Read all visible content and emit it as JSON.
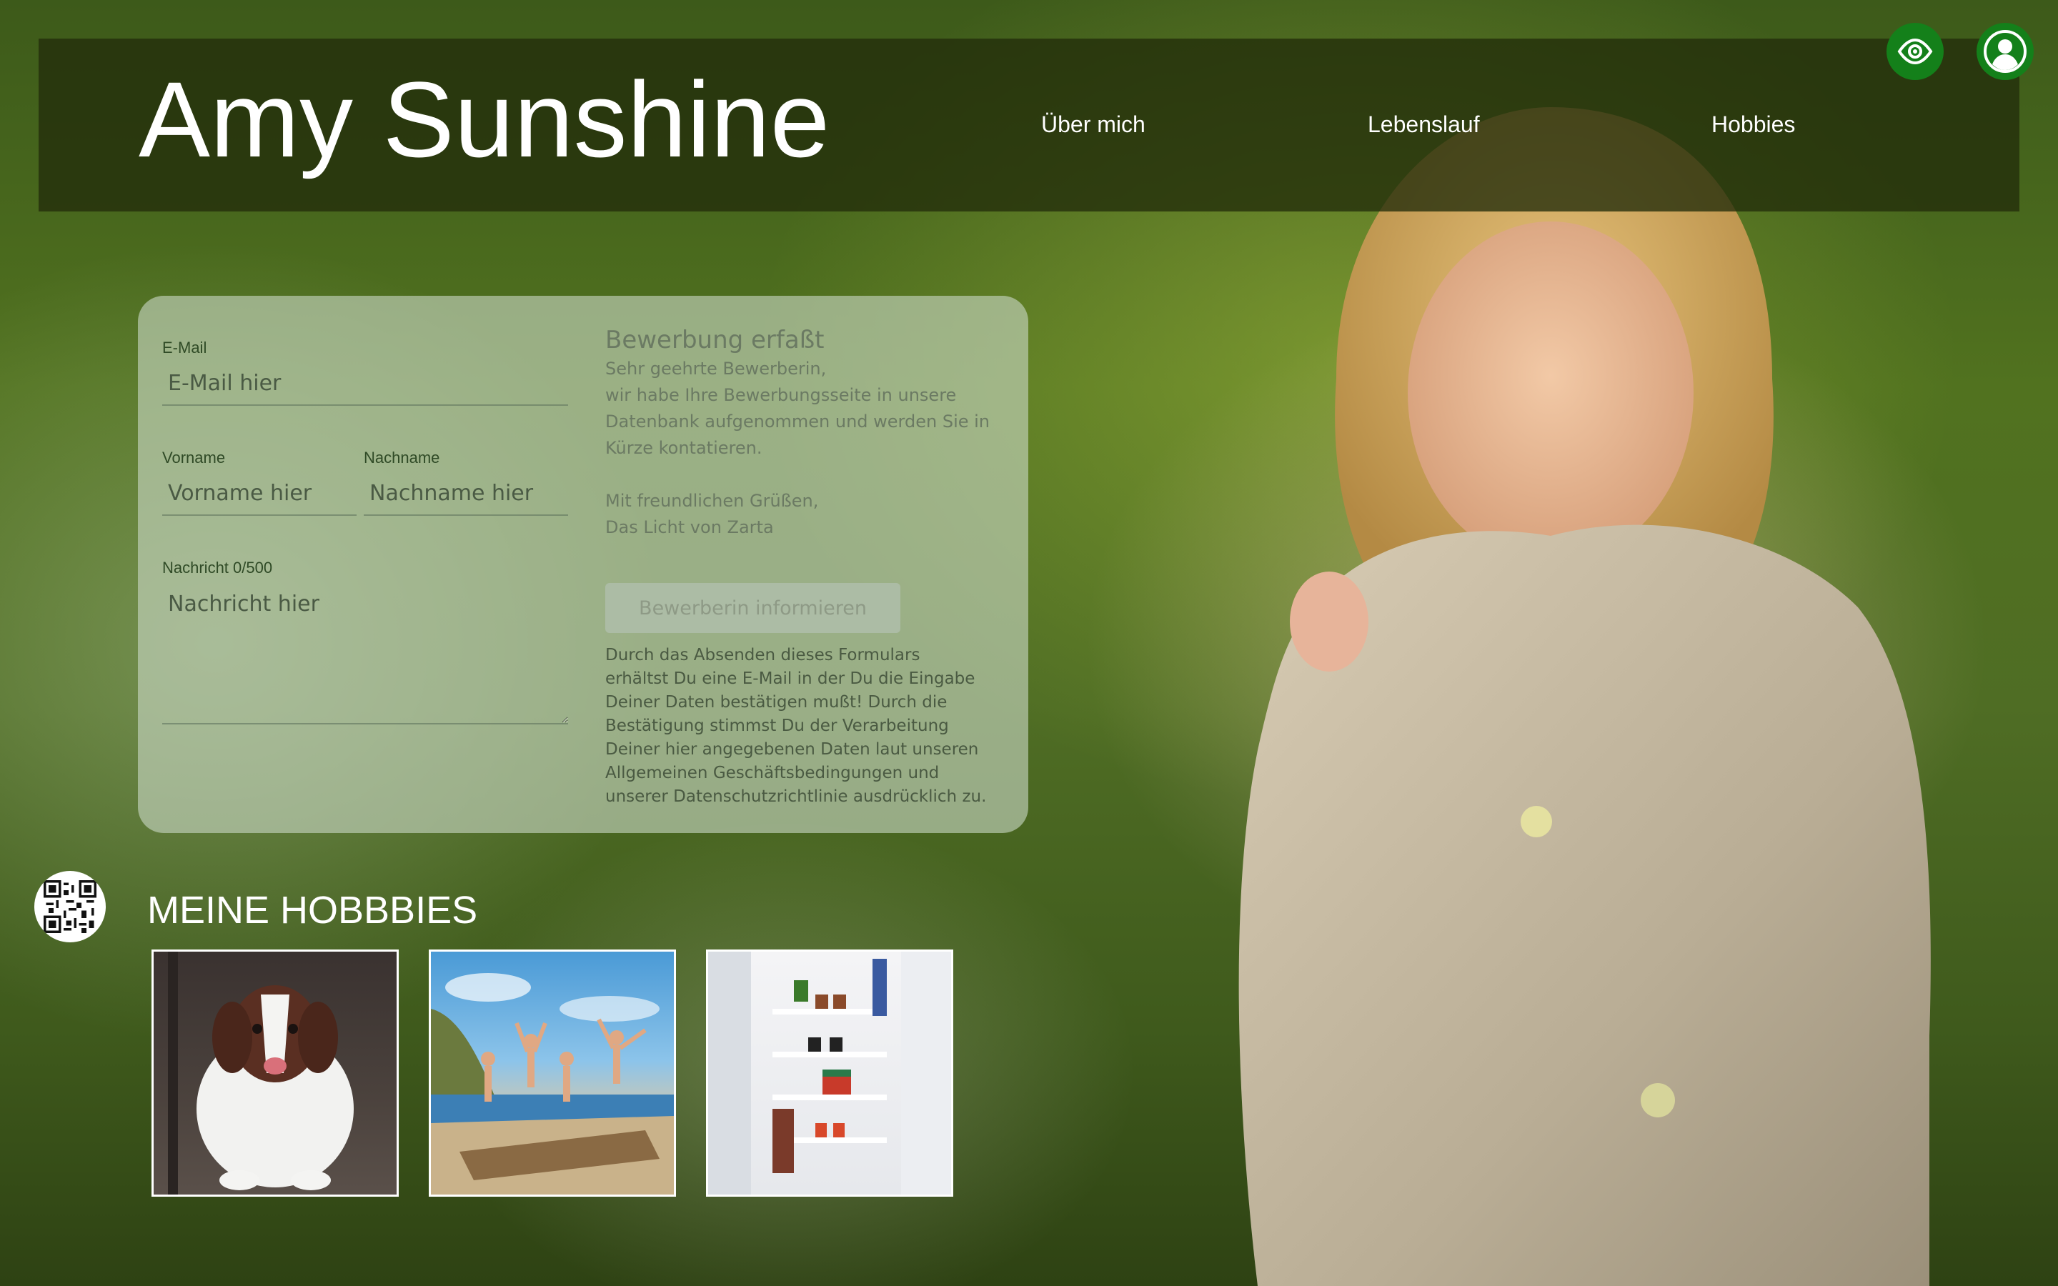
{
  "header": {
    "title": "Amy Sunshine",
    "nav": {
      "about": "Über mich",
      "cv": "Lebenslauf",
      "hobbies": "Hobbies"
    }
  },
  "icons": {
    "visibility": "eye-icon",
    "account": "user-icon",
    "qr": "qr-code-icon"
  },
  "colors": {
    "header_bg": "#232d0a",
    "accent_green": "#14801a"
  },
  "form": {
    "email_label": "E-Mail",
    "email_placeholder": "E-Mail hier",
    "firstname_label": "Vorname",
    "firstname_placeholder": "Vorname hier",
    "lastname_label": "Nachname",
    "lastname_placeholder": "Nachname hier",
    "message_label": "Nachricht 0/500",
    "message_placeholder": "Nachricht hier"
  },
  "confirmation": {
    "title": "Bewerbung erfaßt",
    "lines": [
      "Sehr geehrte Bewerberin,",
      "wir habe Ihre Bewerbungsseite in unsere",
      "Datenbank aufgenommen und werden Sie in",
      "Kürze kontatieren."
    ],
    "closing": [
      "Mit freundlichen Grüßen,",
      "Das Licht von Zarta"
    ],
    "button_label": "Bewerberin informieren",
    "legal": [
      "Durch das Absenden dieses Formulars",
      "erhältst Du eine E-Mail in der Du die Eingabe",
      "Deiner Daten bestätigen mußt! Durch die",
      "Bestätigung stimmst Du der Verarbeitung",
      "Deiner hier angegebenen Daten laut unseren",
      "Allgemeinen Geschäftsbedingungen und",
      "unserer Datenschutzrichtlinie ausdrücklich zu."
    ]
  },
  "hobbies": {
    "title": "MEINE HOBBBIES"
  }
}
